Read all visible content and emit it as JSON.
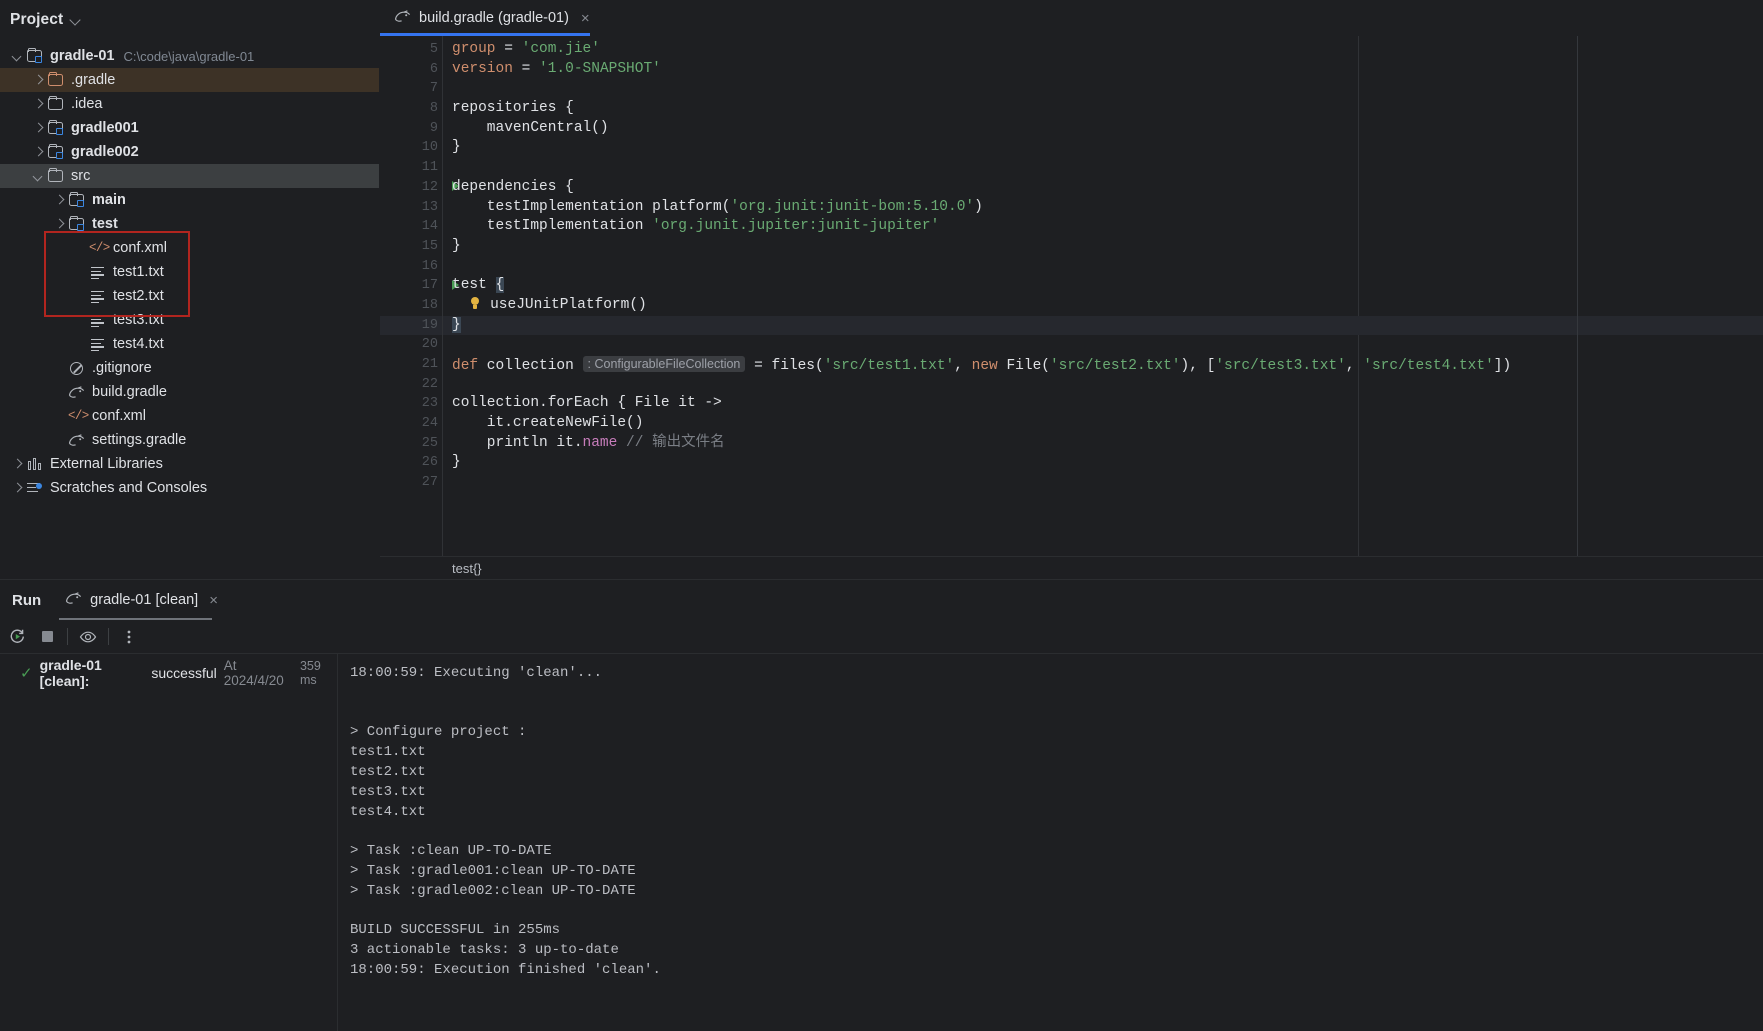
{
  "sidebar": {
    "title": "Project",
    "tree": [
      {
        "label": "gradle-01",
        "sub": "C:\\code\\java\\gradle-01",
        "icon": "gradle-module-icon",
        "arrow": "down",
        "indent": 0,
        "bold": true,
        "state": "none"
      },
      {
        "label": ".gradle",
        "sub": "",
        "icon": "folder-orange-icon",
        "arrow": "right",
        "indent": 1,
        "bold": false,
        "state": "brown"
      },
      {
        "label": ".idea",
        "sub": "",
        "icon": "folder-icon",
        "arrow": "right",
        "indent": 1,
        "bold": false,
        "state": "none"
      },
      {
        "label": "gradle001",
        "sub": "",
        "icon": "gradle-module-icon",
        "arrow": "right",
        "indent": 1,
        "bold": true,
        "state": "none"
      },
      {
        "label": "gradle002",
        "sub": "",
        "icon": "gradle-module-icon",
        "arrow": "right",
        "indent": 1,
        "bold": true,
        "state": "none"
      },
      {
        "label": "src",
        "sub": "",
        "icon": "folder-icon",
        "arrow": "down",
        "indent": 1,
        "bold": false,
        "state": "selected"
      },
      {
        "label": "main",
        "sub": "",
        "icon": "gradle-module-icon",
        "arrow": "right",
        "indent": 2,
        "bold": true,
        "state": "none"
      },
      {
        "label": "test",
        "sub": "",
        "icon": "gradle-module-icon",
        "arrow": "right",
        "indent": 2,
        "bold": true,
        "state": "none"
      },
      {
        "label": "conf.xml",
        "sub": "",
        "icon": "xml-file-icon",
        "arrow": "none",
        "indent": 3,
        "bold": false,
        "state": "none"
      },
      {
        "label": "test1.txt",
        "sub": "",
        "icon": "text-file-icon",
        "arrow": "none",
        "indent": 3,
        "bold": false,
        "state": "none"
      },
      {
        "label": "test2.txt",
        "sub": "",
        "icon": "text-file-icon",
        "arrow": "none",
        "indent": 3,
        "bold": false,
        "state": "none"
      },
      {
        "label": "test3.txt",
        "sub": "",
        "icon": "text-file-icon",
        "arrow": "none",
        "indent": 3,
        "bold": false,
        "state": "none"
      },
      {
        "label": "test4.txt",
        "sub": "",
        "icon": "text-file-icon",
        "arrow": "none",
        "indent": 3,
        "bold": false,
        "state": "none"
      },
      {
        "label": ".gitignore",
        "sub": "",
        "icon": "gitignore-icon",
        "arrow": "none",
        "indent": 2,
        "bold": false,
        "state": "none"
      },
      {
        "label": "build.gradle",
        "sub": "",
        "icon": "gradle-file-icon",
        "arrow": "none",
        "indent": 2,
        "bold": false,
        "state": "none"
      },
      {
        "label": "conf.xml",
        "sub": "",
        "icon": "xml-file-icon",
        "arrow": "none",
        "indent": 2,
        "bold": false,
        "state": "none"
      },
      {
        "label": "settings.gradle",
        "sub": "",
        "icon": "gradle-file-icon",
        "arrow": "none",
        "indent": 2,
        "bold": false,
        "state": "none"
      },
      {
        "label": "External Libraries",
        "sub": "",
        "icon": "library-icon",
        "arrow": "right",
        "indent": 0,
        "bold": false,
        "state": "none"
      },
      {
        "label": "Scratches and Consoles",
        "sub": "",
        "icon": "scratches-icon",
        "arrow": "right",
        "indent": 0,
        "bold": false,
        "state": "none"
      }
    ],
    "highlight_color": "#b2251f"
  },
  "editor": {
    "tab": {
      "label": "build.gradle (gradle-01)",
      "icon": "gradle-file-icon",
      "close": "×"
    },
    "first_line_number": 5,
    "current_line": 19,
    "lines": [
      {
        "n": 5,
        "run": false
      },
      {
        "n": 6,
        "run": false
      },
      {
        "n": 7,
        "run": false
      },
      {
        "n": 8,
        "run": false
      },
      {
        "n": 9,
        "run": false
      },
      {
        "n": 10,
        "run": false
      },
      {
        "n": 11,
        "run": false
      },
      {
        "n": 12,
        "run": true
      },
      {
        "n": 13,
        "run": false
      },
      {
        "n": 14,
        "run": false
      },
      {
        "n": 15,
        "run": false
      },
      {
        "n": 16,
        "run": false
      },
      {
        "n": 17,
        "run": true
      },
      {
        "n": 18,
        "run": false
      },
      {
        "n": 19,
        "run": false
      },
      {
        "n": 20,
        "run": false
      },
      {
        "n": 21,
        "run": false
      },
      {
        "n": 22,
        "run": false
      },
      {
        "n": 23,
        "run": false
      },
      {
        "n": 24,
        "run": false
      },
      {
        "n": 25,
        "run": false
      },
      {
        "n": 26,
        "run": false
      },
      {
        "n": 27,
        "run": false
      }
    ],
    "code": {
      "l5_key": "group",
      "l5_eq": " = ",
      "l5_str": "'com.jie'",
      "l6_key": "version",
      "l6_eq": " = ",
      "l6_str": "'1.0-SNAPSHOT'",
      "l8": "repositories {",
      "l9": "    mavenCentral()",
      "l10": "}",
      "l12": "dependencies {",
      "l13_a": "    testImplementation platform(",
      "l13_s": "'org.junit:junit-bom:5.10.0'",
      "l13_b": ")",
      "l14_a": "    testImplementation ",
      "l14_s": "'org.junit.jupiter:junit-jupiter'",
      "l15": "}",
      "l17_a": "test ",
      "l17_b": "{",
      "l18": "useJUnitPlatform()",
      "l19": "}",
      "l21_kw": "def",
      "l21_name": " collection ",
      "l21_inlay": ": ConfigurableFileCollection",
      "l21_eq": " = files(",
      "l21_s1": "'src/test1.txt'",
      "l21_c1": ", ",
      "l21_new": "new",
      "l21_file": " File(",
      "l21_s2": "'src/test2.txt'",
      "l21_c2": "), [",
      "l21_s3": "'src/test3.txt'",
      "l21_c3": ", ",
      "l21_s4": "'src/test4.txt'",
      "l21_end": "])",
      "l23": "collection.forEach { File it ->",
      "l24": "    it.createNewFile()",
      "l25_a": "    println it.",
      "l25_prop": "name",
      "l25_cmt": " // 输出文件名",
      "l26": "}"
    },
    "breadcrumb": "test{}"
  },
  "run_panel": {
    "title": "Run",
    "tab": {
      "label": "gradle-01 [clean]",
      "icon": "gradle-file-icon",
      "close": "×"
    },
    "toolbar": [
      "rerun-icon",
      "stop-icon",
      "eye-icon",
      "more-options-icon"
    ],
    "result": {
      "status_icon": "checkmark-icon",
      "name": "gradle-01 [clean]:",
      "status": "successful",
      "at": "At 2024/4/20",
      "duration": "359 ms"
    },
    "console": [
      "18:00:59: Executing 'clean'...",
      "",
      "",
      "> Configure project :",
      "test1.txt",
      "test2.txt",
      "test3.txt",
      "test4.txt",
      "",
      "> Task :clean UP-TO-DATE",
      "> Task :gradle001:clean UP-TO-DATE",
      "> Task :gradle002:clean UP-TO-DATE",
      "",
      "BUILD SUCCESSFUL in 255ms",
      "3 actionable tasks: 3 up-to-date",
      "18:00:59: Execution finished 'clean'."
    ]
  }
}
